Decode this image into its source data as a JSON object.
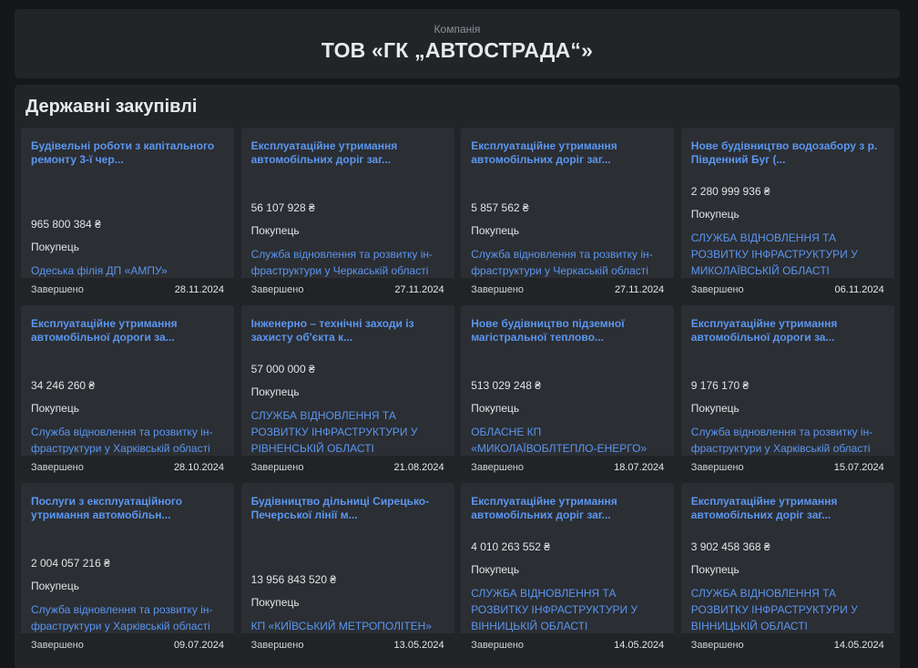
{
  "company": {
    "label": "Компанія",
    "name": "ТОВ «ГК „АВТОСТРАДА“»"
  },
  "procurements": {
    "title": "Державні закупівлі",
    "buyer_label": "Покупець",
    "items": [
      {
        "title": "Будівельні роботи з капітального ремонту 3-ї чер...",
        "amount": "965 800 384 ₴",
        "buyer": "Одеська філія ДП «АМПУ»",
        "status": "Завершено",
        "date": "28.11.2024"
      },
      {
        "title": "Експлуатаційне утримання автомобільних доріг заг...",
        "amount": "56 107 928 ₴",
        "buyer": "Служба відновлення та розвитку ін-фраструктури у Черкаській області",
        "status": "Завершено",
        "date": "27.11.2024"
      },
      {
        "title": "Експлуатаційне утримання автомобільних доріг заг...",
        "amount": "5 857 562 ₴",
        "buyer": "Служба відновлення та розвитку ін-фраструктури у Черкаській області",
        "status": "Завершено",
        "date": "27.11.2024"
      },
      {
        "title": "Нове будівництво водозабору з р. Південний Буг (...",
        "amount": "2 280 999 936 ₴",
        "buyer": "СЛУЖБА ВІДНОВЛЕННЯ ТА РОЗВИТКУ ІНФРАСТРУКТУРИ У МИКОЛАЇВСЬКІЙ ОБЛАСТІ",
        "status": "Завершено",
        "date": "06.11.2024"
      },
      {
        "title": "Експлуатаційне утримання автомобільної дороги за...",
        "amount": "34 246 260 ₴",
        "buyer": "Служба відновлення та розвитку ін-фраструктури у Харківській області",
        "status": "Завершено",
        "date": "28.10.2024"
      },
      {
        "title": "Інженерно – технічні заходи із захисту об'єкта к...",
        "amount": "57 000 000 ₴",
        "buyer": "СЛУЖБА ВІДНОВЛЕННЯ ТА РОЗВИТКУ ІНФРАСТРУКТУРИ У РІВНЕНСЬКІЙ ОБЛАСТІ",
        "status": "Завершено",
        "date": "21.08.2024"
      },
      {
        "title": "Нове будівництво підземної магістральної теплово...",
        "amount": "513 029 248 ₴",
        "buyer": "ОБЛАСНЕ КП «МИКОЛАЇВОБЛТЕПЛО-ЕНЕРГО»",
        "status": "Завершено",
        "date": "18.07.2024"
      },
      {
        "title": "Експлуатаційне утримання автомобільної дороги за...",
        "amount": "9 176 170 ₴",
        "buyer": "Служба відновлення та розвитку ін-фраструктури у Харківській області",
        "status": "Завершено",
        "date": "15.07.2024"
      },
      {
        "title": "Послуги з експлуатаційного утримання автомобільн...",
        "amount": "2 004 057 216 ₴",
        "buyer": "Служба відновлення та розвитку ін-фраструктури у Харківській області",
        "status": "Завершено",
        "date": "09.07.2024"
      },
      {
        "title": "Будівництво дільниці Сирецько-Печерської лінії м...",
        "amount": "13 956 843 520 ₴",
        "buyer": "КП «КИЇВСЬКИЙ МЕТРОПОЛІТЕН»",
        "status": "Завершено",
        "date": "13.05.2024"
      },
      {
        "title": "Експлуатаційне утримання автомобільних доріг заг...",
        "amount": "4 010 263 552 ₴",
        "buyer": "СЛУЖБА ВІДНОВЛЕННЯ ТА РОЗВИТКУ ІНФРАСТРУКТУРИ У ВІННИЦЬКІЙ ОБЛАСТІ",
        "status": "Завершено",
        "date": "14.05.2024"
      },
      {
        "title": "Експлуатаційне утримання автомобільних доріг заг...",
        "amount": "3 902 458 368 ₴",
        "buyer": "СЛУЖБА ВІДНОВЛЕННЯ ТА РОЗВИТКУ ІНФРАСТРУКТУРИ У ВІННИЦЬКІЙ ОБЛАСТІ",
        "status": "Завершено",
        "date": "14.05.2024"
      }
    ]
  }
}
